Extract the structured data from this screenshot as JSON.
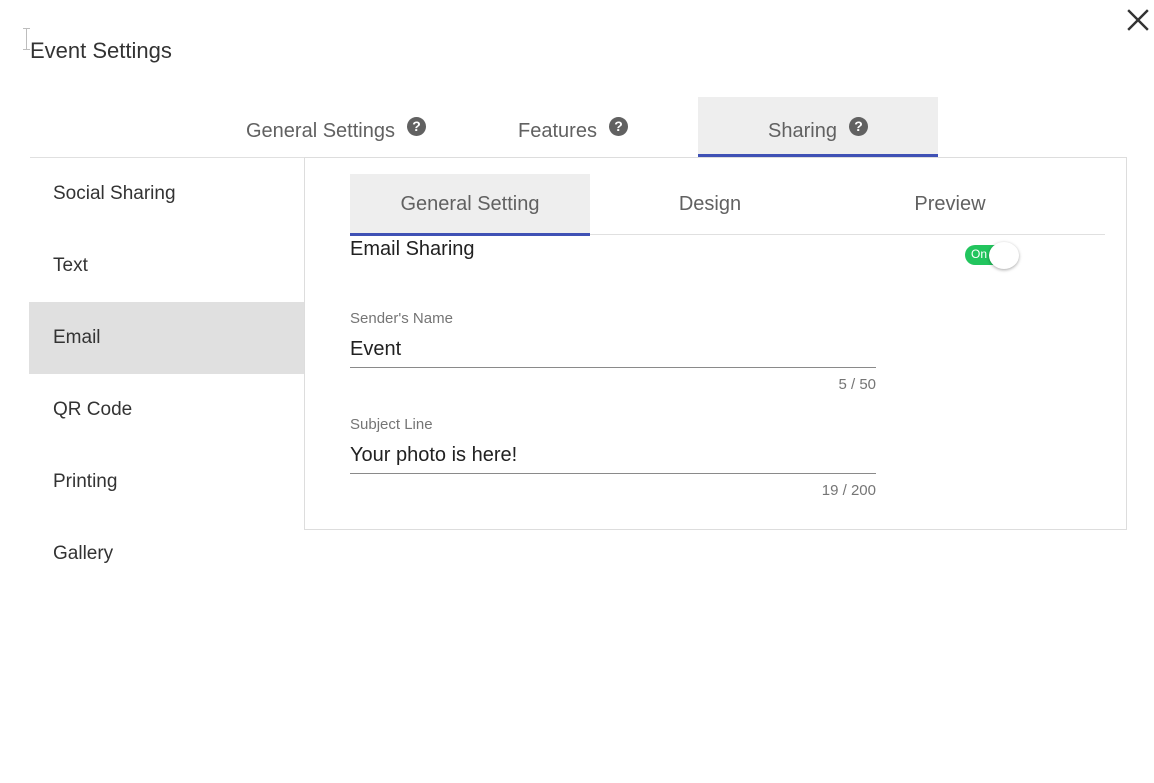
{
  "dialog": {
    "title": "Event Settings"
  },
  "top_tabs": [
    {
      "label": "General Settings",
      "help": "?"
    },
    {
      "label": "Features",
      "help": "?"
    },
    {
      "label": "Sharing",
      "help": "?",
      "active": true
    }
  ],
  "sidebar": {
    "items": [
      {
        "label": "Social Sharing"
      },
      {
        "label": "Text"
      },
      {
        "label": "Email",
        "active": true
      },
      {
        "label": "QR Code"
      },
      {
        "label": "Printing"
      },
      {
        "label": "Gallery"
      }
    ]
  },
  "sub_tabs": [
    {
      "label": "General Setting",
      "active": true
    },
    {
      "label": "Design"
    },
    {
      "label": "Preview"
    }
  ],
  "email_sharing": {
    "title": "Email Sharing",
    "toggle_label": "On",
    "toggle_state": true
  },
  "fields": {
    "sender_name": {
      "label": "Sender's Name",
      "value": "Event",
      "counter": "5 / 50"
    },
    "subject_line": {
      "label": "Subject Line",
      "value": "Your photo is here!",
      "counter": "19 / 200"
    }
  },
  "icons": {
    "close": "close-icon",
    "help": "help-circle-icon"
  },
  "colors": {
    "accent": "#3f51b5",
    "toggle_on": "#22c55e",
    "active_bg": "#e0e0e0",
    "tab_bg": "#eeeeee"
  }
}
